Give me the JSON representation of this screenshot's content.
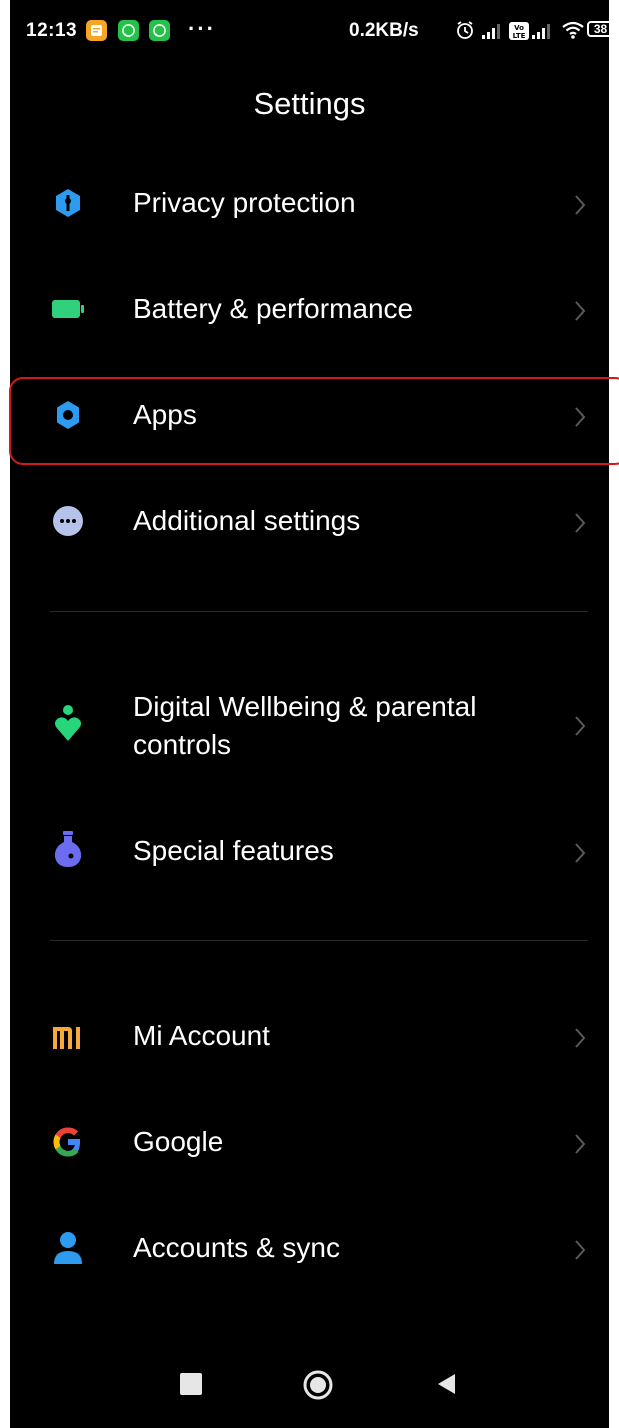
{
  "status_bar": {
    "time": "12:13",
    "more": "···",
    "net_speed": "0.2KB/s",
    "volte_label": "Vo LTE",
    "battery": "38",
    "notification_icons": [
      "notes-app-icon",
      "whatsapp-icon",
      "whatsapp-icon"
    ],
    "status_icons": [
      "alarm-icon",
      "signal-icon",
      "volte-icon",
      "signal-icon",
      "wifi-icon",
      "battery-icon"
    ]
  },
  "header": {
    "title": "Settings"
  },
  "menu": {
    "items": [
      {
        "label": "Privacy protection",
        "icon": "shield-icon",
        "color": "#2d9bf0"
      },
      {
        "label": "Battery & performance",
        "icon": "battery-icon",
        "color": "#31d07c"
      },
      {
        "label": "Apps",
        "icon": "gear-icon",
        "color": "#2d9bf0"
      },
      {
        "label": "Additional settings",
        "icon": "more-dots-icon",
        "color": "#b5c2ea"
      },
      {
        "label": "Digital Wellbeing & parental controls",
        "label_line1": "Digital Wellbeing & parental",
        "label_line2": "controls",
        "icon": "wellbeing-icon",
        "color": "#27d67a"
      },
      {
        "label": "Special features",
        "icon": "flask-icon",
        "color": "#6c6cf0"
      },
      {
        "label": "Mi Account",
        "icon": "mi-logo-icon",
        "color": "#f5a93b"
      },
      {
        "label": "Google",
        "icon": "google-icon",
        "color": "#4285f4"
      },
      {
        "label": "Accounts & sync",
        "icon": "person-icon",
        "color": "#2d9bf0"
      }
    ]
  },
  "colors": {
    "background": "#000000",
    "highlight": "#d11a1a",
    "chevron": "#5a5a5a"
  },
  "navbar": {
    "buttons": [
      "recents-square-icon",
      "home-circle-icon",
      "back-triangle-icon"
    ]
  }
}
